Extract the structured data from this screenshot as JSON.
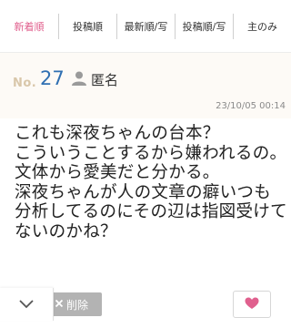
{
  "tabs": [
    {
      "label": "新着順",
      "active": true
    },
    {
      "label": "投稿順",
      "active": false
    },
    {
      "label": "最新順/写",
      "active": false
    },
    {
      "label": "投稿順/写",
      "active": false
    },
    {
      "label": "主のみ",
      "active": false
    }
  ],
  "post": {
    "no_label": "No.",
    "number": "27",
    "author": "匿名",
    "timestamp": "23/10/05 00:14",
    "body": "これも深夜ちゃんの台本？\nこういうことするから嫌われるの。文体から愛美だと分かる。\n深夜ちゃんが人の文章の癖いつも分析してるのにその辺は指図受けてないのかね？"
  },
  "actions": {
    "delete_label": "削除"
  },
  "icons": {
    "user": "user-icon",
    "close": "close-icon",
    "chevron": "chevron-down-icon",
    "heart": "heart-icon"
  },
  "colors": {
    "accent": "#e0608e",
    "number": "#2f6fb2",
    "no_label": "#d9c7aa"
  }
}
